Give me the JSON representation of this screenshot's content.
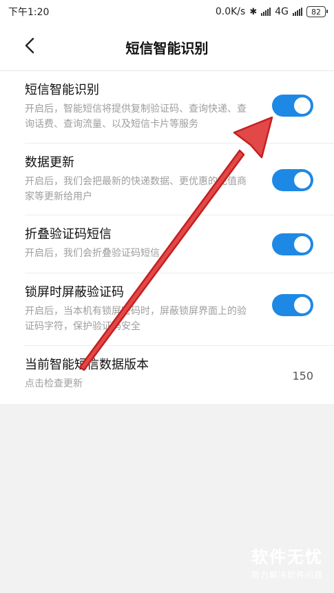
{
  "status_bar": {
    "time": "下午1:20",
    "speed": "0.0K/s",
    "network": "4G",
    "battery": "82"
  },
  "header": {
    "title": "短信智能识别",
    "back_icon": "chevron-left-icon"
  },
  "settings": [
    {
      "label": "短信智能识别",
      "description": "开启后，智能短信将提供复制验证码、查询快递、查询话费、查询流量、以及短信卡片等服务",
      "toggle_on": true
    },
    {
      "label": "数据更新",
      "description": "开启后，我们会把最新的快递数据、更优惠的充值商家等更新给用户",
      "toggle_on": true
    },
    {
      "label": "折叠验证码短信",
      "description": "开启后，我们会折叠验证码短信",
      "toggle_on": true
    },
    {
      "label": "锁屏时屏蔽验证码",
      "description": "开启后，当本机有锁屏密码时，屏蔽锁屏界面上的验证码字符，保护验证码安全",
      "toggle_on": true
    }
  ],
  "version": {
    "label": "当前智能短信数据版本",
    "description": "点击检查更新",
    "value": "150"
  },
  "watermark": {
    "title": "软件无忧",
    "subtitle": "努力解决软件问题"
  },
  "colors": {
    "accent": "#1e88e5",
    "annotation_arrow": "#d62a2a",
    "background": "#f2f2f2"
  }
}
